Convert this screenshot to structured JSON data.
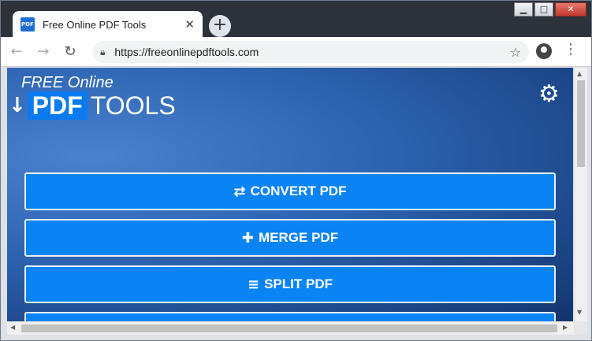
{
  "browser": {
    "tab_title": "Free Online PDF Tools",
    "tab_close": "✕",
    "new_tab": "+",
    "url": "https://freeonlinepdftools.com"
  },
  "icons": {
    "back": "back-arrow-icon",
    "forward": "forward-arrow-icon",
    "reload": "reload-icon",
    "lock": "lock-icon",
    "star": "star-icon",
    "profile": "profile-icon",
    "menu": "kebab-menu-icon",
    "gear": "gear-icon"
  },
  "site": {
    "logo_free": "FREE Online",
    "logo_pdf": "PDF",
    "logo_tools": "TOOLS",
    "buttons": [
      {
        "label": "CONVERT PDF",
        "icon": "⇄"
      },
      {
        "label": "MERGE PDF",
        "icon": "✚"
      },
      {
        "label": "SPLIT PDF",
        "icon": "≡"
      },
      {
        "label": "",
        "icon": ""
      }
    ]
  },
  "colors": {
    "button_blue": "#0a84f5",
    "logo_pdf_bg": "#0a7bef"
  }
}
